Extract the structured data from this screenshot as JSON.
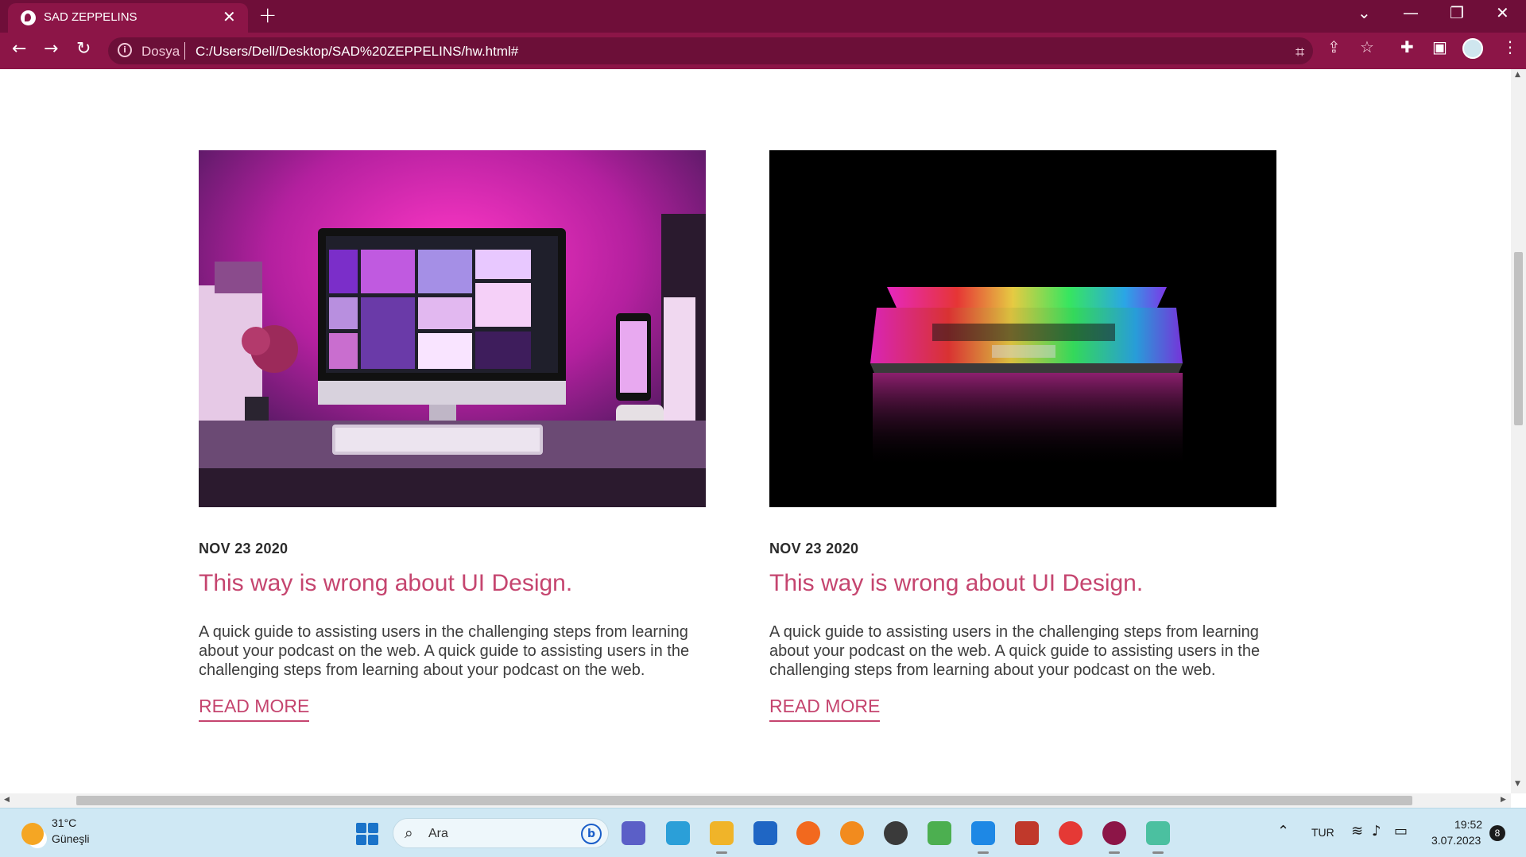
{
  "browser": {
    "tab_title": "SAD ZEPPELINS",
    "tab_close": "✕",
    "new_tab": "+",
    "window_controls": {
      "collapse": "⌄",
      "minimize": "—",
      "restore": "❐",
      "close": "✕"
    },
    "nav": {
      "back": "←",
      "forward": "→",
      "reload": "↻"
    },
    "address_label": "Dosya",
    "url": "C:/Users/Dell/Desktop/SAD%20ZEPPELINS/hw.html#",
    "icons": [
      "translate-icon",
      "share-icon",
      "star-icon",
      "extensions-icon",
      "sidepanel-icon",
      "profile-icon",
      "menu-icon"
    ]
  },
  "page": {
    "cards": [
      {
        "image_desc": "desk-setup-pink-lighting",
        "date": "NOV 23 2020",
        "title": "This way is wrong about UI Design.",
        "text": "A quick guide to assisting users in the challenging steps from learning about your podcast on the web. A quick guide to assisting users in the challenging steps from learning about your podcast on the web.",
        "link": "READ MORE"
      },
      {
        "image_desc": "laptop-rainbow-keyboard-dark",
        "date": "NOV 23 2020",
        "title": "This way is wrong about UI Design.",
        "text": "A quick guide to assisting users in the challenging steps from learning about your podcast on the web. A quick guide to assisting users in the challenging steps from learning about your podcast on the web.",
        "link": "READ MORE"
      }
    ]
  },
  "taskbar": {
    "weather_temp": "31°C",
    "weather_cond": "Güneşli",
    "search_label": "Ara",
    "language": "TUR",
    "time": "19:52",
    "date": "3.07.2023",
    "notifications": "8"
  },
  "colors": {
    "chrome_dark": "#6f0e39",
    "chrome_tab": "#8c1547",
    "accent": "#c5456f",
    "taskbar": "#cfe8f4"
  }
}
